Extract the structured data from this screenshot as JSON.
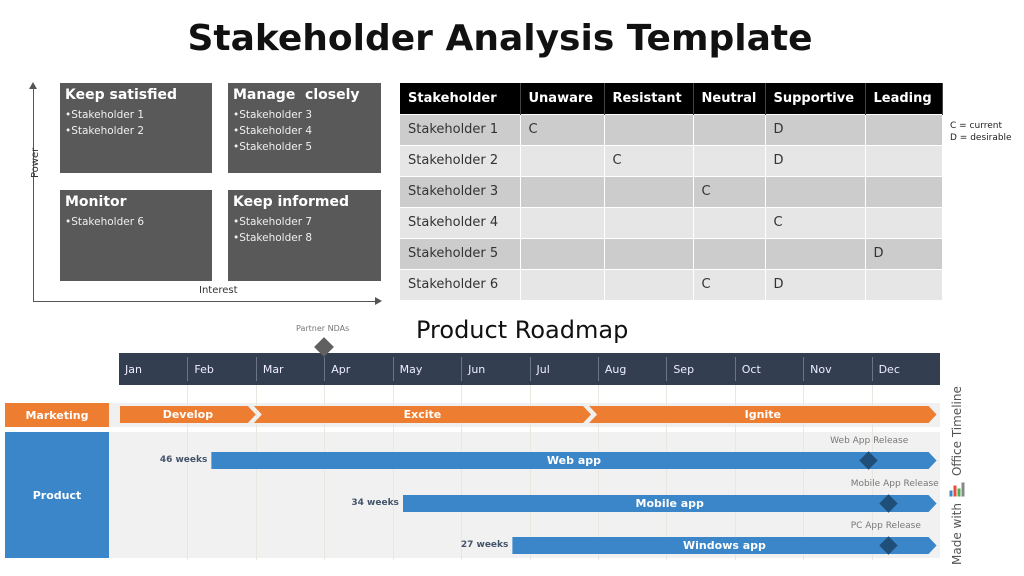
{
  "title": "Stakeholder Analysis Template",
  "matrix": {
    "y_label": "Power",
    "x_label": "Interest",
    "quadrants": [
      {
        "title": "Keep satisfied",
        "items": [
          "Stakeholder 1",
          "Stakeholder 2"
        ]
      },
      {
        "title": "Manage  closely",
        "items": [
          "Stakeholder 3",
          "Stakeholder 4",
          "Stakeholder 5"
        ]
      },
      {
        "title": "Monitor",
        "items": [
          "Stakeholder 6"
        ]
      },
      {
        "title": "Keep informed",
        "items": [
          "Stakeholder 7",
          "Stakeholder 8"
        ]
      }
    ]
  },
  "table": {
    "headers": [
      "Stakeholder",
      "Unaware",
      "Resistant",
      "Neutral",
      "Supportive",
      "Leading"
    ],
    "rows": [
      [
        "Stakeholder 1",
        "C",
        "",
        "",
        "D",
        ""
      ],
      [
        "Stakeholder 2",
        "",
        "C",
        "",
        "D",
        ""
      ],
      [
        "Stakeholder 3",
        "",
        "",
        "C",
        "",
        ""
      ],
      [
        "Stakeholder 4",
        "",
        "",
        "",
        "C",
        ""
      ],
      [
        "Stakeholder 5",
        "",
        "",
        "",
        "",
        "D"
      ],
      [
        "Stakeholder 6",
        "",
        "",
        "C",
        "D",
        ""
      ]
    ],
    "legend": [
      "C = current",
      "D = desirable"
    ]
  },
  "roadmap": {
    "title": "Product Roadmap",
    "months": [
      "Jan",
      "Feb",
      "Mar",
      "Apr",
      "May",
      "Jun",
      "Jul",
      "Aug",
      "Sep",
      "Oct",
      "Nov",
      "Dec"
    ],
    "top_milestone": {
      "label": "Partner NDAs",
      "month_pos": 3.0
    },
    "swimlanes": [
      {
        "label": "Marketing",
        "color": "#ed7d31"
      },
      {
        "label": "Product",
        "color": "#3a86c8"
      }
    ],
    "phases": [
      {
        "label": "Develop",
        "start": 0.0,
        "end": 2.0
      },
      {
        "label": "Excite",
        "start": 2.0,
        "end": 6.9
      },
      {
        "label": "Ignite",
        "start": 6.9,
        "end": 11.95
      }
    ],
    "tasks": [
      {
        "label": "Web app",
        "duration": "46 weeks",
        "start": 1.35,
        "end": 11.95,
        "milestone": {
          "label": "Web App Release",
          "pos": 10.95
        }
      },
      {
        "label": "Mobile app",
        "duration": "34 weeks",
        "start": 4.15,
        "end": 11.95,
        "milestone": {
          "label": "Mobile App Release",
          "pos": 11.25
        }
      },
      {
        "label": "Windows app",
        "duration": "27 weeks",
        "start": 5.75,
        "end": 11.95,
        "milestone": {
          "label": "PC App Release",
          "pos": 11.25
        }
      }
    ],
    "colors": {
      "phase": "#ed7d31",
      "task": "#3a86c8",
      "milestone": "#1f4e79",
      "header": "#333f50"
    }
  },
  "branding": {
    "prefix": "Made with",
    "name": "Office Timeline"
  }
}
